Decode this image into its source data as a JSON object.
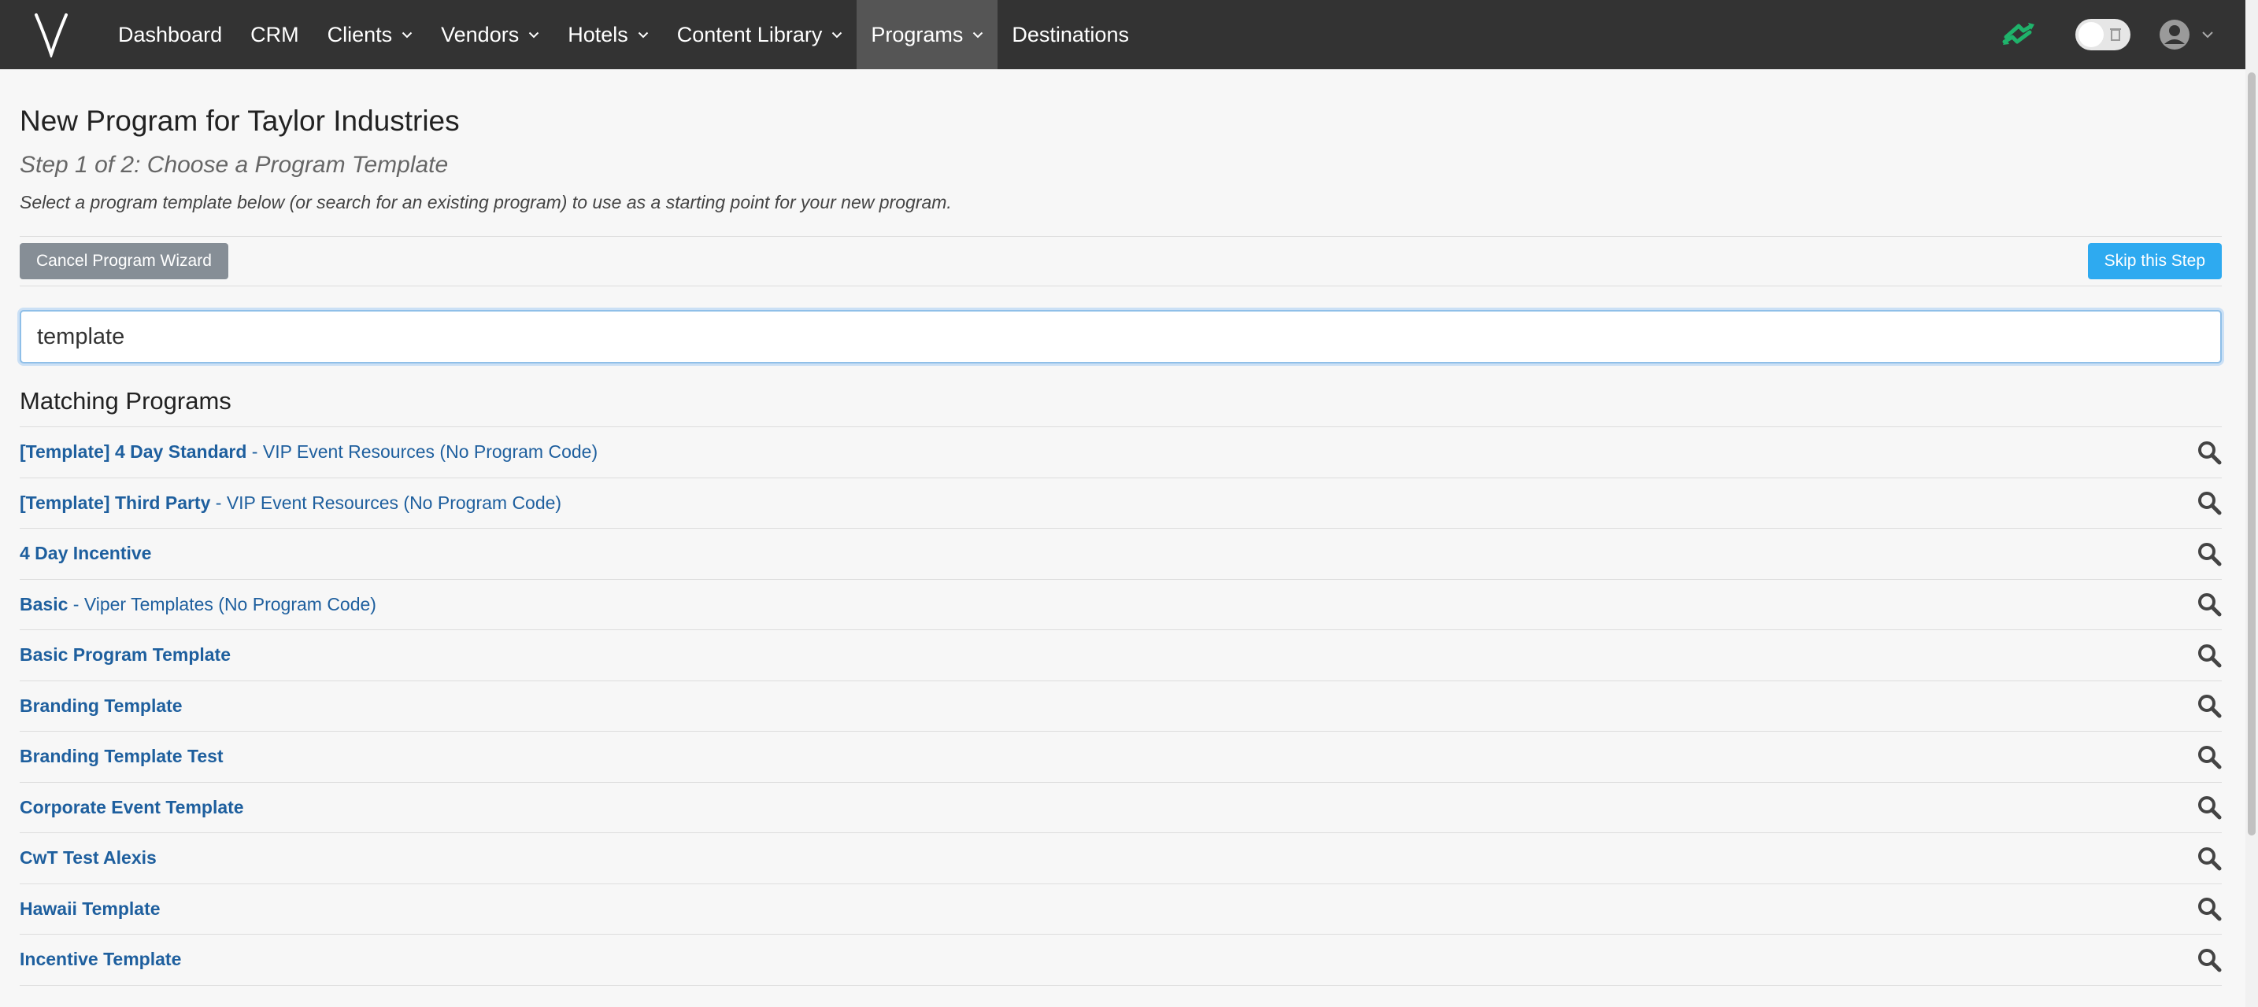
{
  "navbar": {
    "logo": "V",
    "items": [
      {
        "label": "Dashboard",
        "caret": false,
        "active": false
      },
      {
        "label": "CRM",
        "caret": false,
        "active": false
      },
      {
        "label": "Clients",
        "caret": true,
        "active": false
      },
      {
        "label": "Vendors",
        "caret": true,
        "active": false
      },
      {
        "label": "Hotels",
        "caret": true,
        "active": false
      },
      {
        "label": "Content Library",
        "caret": true,
        "active": false
      },
      {
        "label": "Programs",
        "caret": true,
        "active": true
      },
      {
        "label": "Destinations",
        "caret": false,
        "active": false
      }
    ],
    "sync_icon_color": "#1fb36b",
    "nav_bg": "#333333"
  },
  "page": {
    "title": "New Program for Taylor Industries",
    "step_title": "Step 1 of 2: Choose a Program Template",
    "step_desc": "Select a program template below (or search for an existing program) to use as a starting point for your new program."
  },
  "actions": {
    "cancel_label": "Cancel Program Wizard",
    "skip_label": "Skip this Step"
  },
  "search": {
    "value": "template"
  },
  "results": {
    "title": "Matching Programs",
    "items": [
      {
        "name": "[Template] 4 Day Standard",
        "sub": " - VIP Event Resources (No Program Code)"
      },
      {
        "name": "[Template] Third Party",
        "sub": " - VIP Event Resources (No Program Code)"
      },
      {
        "name": "4 Day Incentive",
        "sub": ""
      },
      {
        "name": "Basic",
        "sub": " - Viper Templates (No Program Code)"
      },
      {
        "name": "Basic Program Template",
        "sub": ""
      },
      {
        "name": "Branding Template",
        "sub": ""
      },
      {
        "name": "Branding Template Test",
        "sub": ""
      },
      {
        "name": "Corporate Event Template",
        "sub": ""
      },
      {
        "name": "CwT Test Alexis",
        "sub": ""
      },
      {
        "name": "Hawaii Template",
        "sub": ""
      },
      {
        "name": "Incentive Template",
        "sub": ""
      }
    ]
  },
  "colors": {
    "link": "#1e5f9e",
    "skip_button": "#2eaaf0",
    "cancel_button": "#868e96"
  }
}
